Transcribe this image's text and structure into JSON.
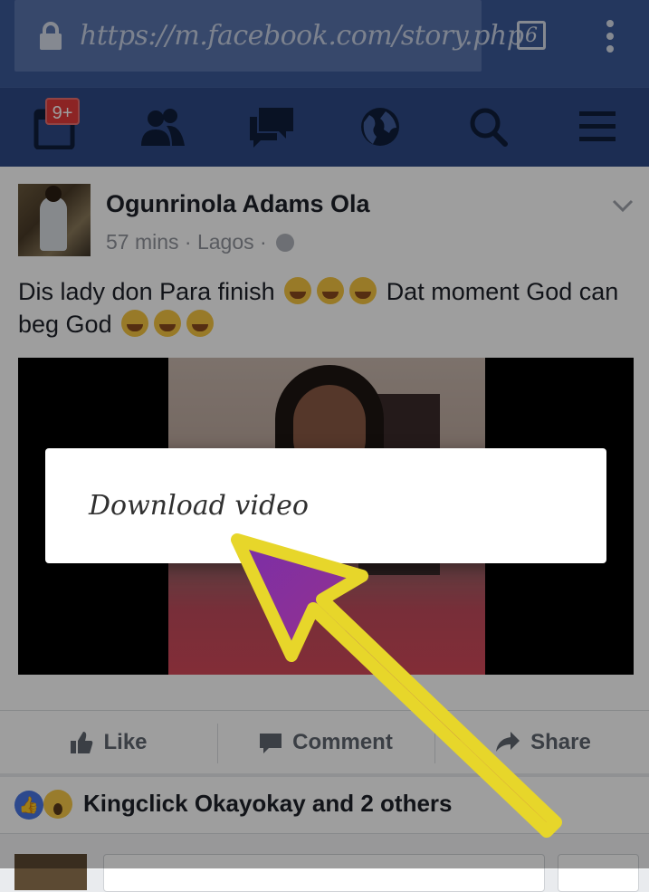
{
  "browser": {
    "url": "https://m.facebook.com/story.php",
    "tab_count": "6",
    "icons": [
      "lock-icon",
      "overflow-menu-icon"
    ]
  },
  "nav": {
    "notification_badge": "9+",
    "icons": [
      "notifications-icon",
      "friends-icon",
      "messages-icon",
      "globe-icon",
      "search-icon",
      "menu-icon"
    ]
  },
  "post": {
    "author": "Ogunrinola Adams Ola",
    "meta": "57 mins · Lagos ·",
    "text_part1": "Dis lady don Para finish",
    "text_part2": "Dat moment God can beg God",
    "actions": {
      "like": "Like",
      "comment": "Comment",
      "share": "Share"
    }
  },
  "reactions": {
    "summary": "Kingclick Okayokay and 2 others"
  },
  "popup": {
    "item": "Download video"
  },
  "colors": {
    "facebook_blue": "#3b5998",
    "arrow_yellow": "#e7d62a",
    "arrow_purple": "#7a2fa8"
  }
}
